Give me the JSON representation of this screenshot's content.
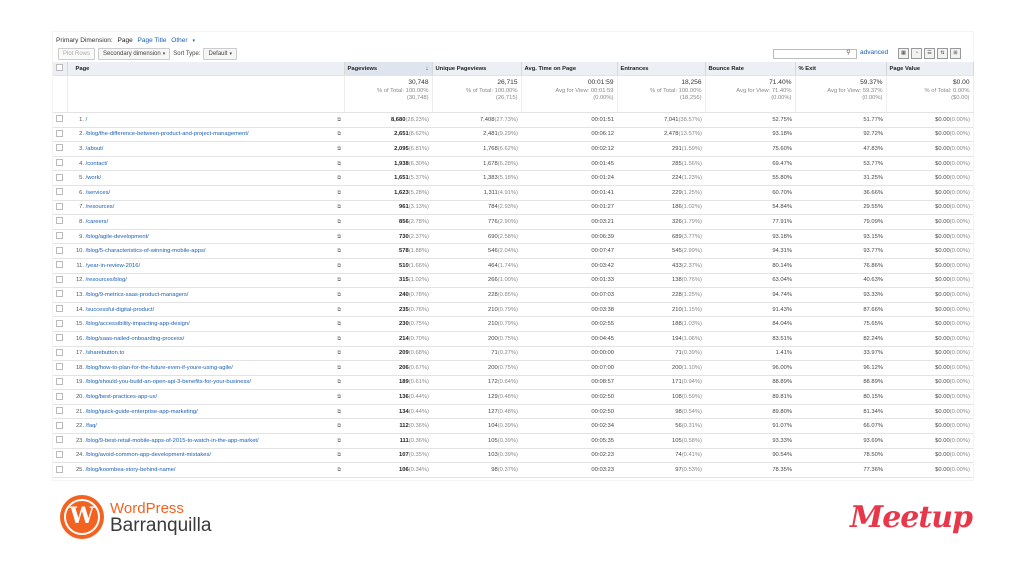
{
  "primary_dimension": {
    "label": "Primary Dimension:",
    "selected": "Page",
    "option_page_title": "Page Title",
    "option_other": "Other"
  },
  "controls": {
    "plot_rows": "Plot Rows",
    "secondary_dimension": "Secondary dimension",
    "sort_type_label": "Sort Type:",
    "sort_type_value": "Default",
    "advanced": "advanced"
  },
  "columns": [
    "Page",
    "Pageviews",
    "Unique Pageviews",
    "Avg. Time on Page",
    "Entrances",
    "Bounce Rate",
    "% Exit",
    "Page Value"
  ],
  "totals": [
    {
      "big": "30,748",
      "l1": "% of Total: 100.00%",
      "l2": "(30,748)"
    },
    {
      "big": "26,715",
      "l1": "% of Total: 100.00%",
      "l2": "(26,715)"
    },
    {
      "big": "00:01:59",
      "l1": "Avg for View: 00:01:59",
      "l2": "(0.00%)"
    },
    {
      "big": "18,256",
      "l1": "% of Total: 100.00%",
      "l2": "(18,256)"
    },
    {
      "big": "71.40%",
      "l1": "Avg for View: 71.40%",
      "l2": "(0.00%)"
    },
    {
      "big": "59.37%",
      "l1": "Avg for View: 59.37%",
      "l2": "(0.00%)"
    },
    {
      "big": "$0.00",
      "l1": "% of Total: 0.00%",
      "l2": "($0.00)"
    }
  ],
  "rows": [
    [
      "1.",
      "/",
      "8,680",
      "(28.23%)",
      "7,408",
      "(27.73%)",
      "00:01:51",
      "7,041",
      "(38.57%)",
      "52.75%",
      "51.77%",
      "$0.00",
      "(0.00%)"
    ],
    [
      "2.",
      "/blog/the-difference-between-product-and-project-management/",
      "2,651",
      "(8.62%)",
      "2,481",
      "(9.29%)",
      "00:06:12",
      "2,478",
      "(13.57%)",
      "93.18%",
      "92.72%",
      "$0.00",
      "(0.00%)"
    ],
    [
      "3.",
      "/about/",
      "2,095",
      "(6.81%)",
      "1,768",
      "(6.62%)",
      "00:02:12",
      "291",
      "(1.59%)",
      "75.60%",
      "47.83%",
      "$0.00",
      "(0.00%)"
    ],
    [
      "4.",
      "/contact/",
      "1,938",
      "(6.30%)",
      "1,678",
      "(6.28%)",
      "00:01:45",
      "285",
      "(1.56%)",
      "69.47%",
      "53.77%",
      "$0.00",
      "(0.00%)"
    ],
    [
      "5.",
      "/work/",
      "1,651",
      "(5.37%)",
      "1,383",
      "(5.18%)",
      "00:01:24",
      "224",
      "(1.23%)",
      "55.80%",
      "31.25%",
      "$0.00",
      "(0.00%)"
    ],
    [
      "6.",
      "/services/",
      "1,623",
      "(5.28%)",
      "1,311",
      "(4.91%)",
      "00:01:41",
      "229",
      "(1.25%)",
      "60.70%",
      "36.66%",
      "$0.00",
      "(0.00%)"
    ],
    [
      "7.",
      "/resources/",
      "961",
      "(3.13%)",
      "784",
      "(2.93%)",
      "00:01:27",
      "186",
      "(1.02%)",
      "54.84%",
      "29.55%",
      "$0.00",
      "(0.00%)"
    ],
    [
      "8.",
      "/careers/",
      "856",
      "(2.78%)",
      "776",
      "(2.90%)",
      "00:03:21",
      "326",
      "(1.79%)",
      "77.91%",
      "79.09%",
      "$0.00",
      "(0.00%)"
    ],
    [
      "9.",
      "/blog/agile-development/",
      "730",
      "(2.37%)",
      "690",
      "(2.58%)",
      "00:06:39",
      "689",
      "(3.77%)",
      "93.18%",
      "93.15%",
      "$0.00",
      "(0.00%)"
    ],
    [
      "10.",
      "/blog/5-characteristics-of-winning-mobile-apps/",
      "578",
      "(1.88%)",
      "546",
      "(2.04%)",
      "00:07:47",
      "545",
      "(2.99%)",
      "94.31%",
      "93.77%",
      "$0.00",
      "(0.00%)"
    ],
    [
      "11.",
      "/year-in-review-2016/",
      "510",
      "(1.66%)",
      "464",
      "(1.74%)",
      "00:03:42",
      "433",
      "(2.37%)",
      "80.14%",
      "76.86%",
      "$0.00",
      "(0.00%)"
    ],
    [
      "12.",
      "/resources/blog/",
      "315",
      "(1.02%)",
      "266",
      "(1.00%)",
      "00:01:33",
      "138",
      "(0.76%)",
      "63.04%",
      "40.63%",
      "$0.00",
      "(0.00%)"
    ],
    [
      "13.",
      "/blog/9-metrics-saas-product-managers/",
      "240",
      "(0.78%)",
      "228",
      "(0.85%)",
      "00:07:03",
      "228",
      "(1.25%)",
      "94.74%",
      "93.33%",
      "$0.00",
      "(0.00%)"
    ],
    [
      "14.",
      "/successful-digital-product/",
      "235",
      "(0.76%)",
      "210",
      "(0.79%)",
      "00:03:38",
      "210",
      "(1.15%)",
      "91.43%",
      "87.66%",
      "$0.00",
      "(0.00%)"
    ],
    [
      "15.",
      "/blog/accessibility-impacting-app-design/",
      "230",
      "(0.75%)",
      "210",
      "(0.79%)",
      "00:02:55",
      "188",
      "(1.03%)",
      "84.04%",
      "75.65%",
      "$0.00",
      "(0.00%)"
    ],
    [
      "16.",
      "/blog/saas-nailed-onboarding-process/",
      "214",
      "(0.70%)",
      "200",
      "(0.75%)",
      "00:04:45",
      "194",
      "(1.06%)",
      "83.51%",
      "82.24%",
      "$0.00",
      "(0.00%)"
    ],
    [
      "17.",
      "/sharebutton.to",
      "209",
      "(0.68%)",
      "71",
      "(0.27%)",
      "00:00:00",
      "71",
      "(0.39%)",
      "1.41%",
      "33.97%",
      "$0.00",
      "(0.00%)"
    ],
    [
      "18.",
      "/blog/how-to-plan-for-the-future-even-if-youre-using-agile/",
      "206",
      "(0.67%)",
      "200",
      "(0.75%)",
      "00:07:00",
      "200",
      "(1.10%)",
      "96.00%",
      "96.12%",
      "$0.00",
      "(0.00%)"
    ],
    [
      "19.",
      "/blog/should-you-build-an-open-api-3-benefits-for-your-business/",
      "189",
      "(0.61%)",
      "172",
      "(0.64%)",
      "00:08:57",
      "171",
      "(0.94%)",
      "88.89%",
      "88.89%",
      "$0.00",
      "(0.00%)"
    ],
    [
      "20.",
      "/blog/best-practices-app-ux/",
      "136",
      "(0.44%)",
      "129",
      "(0.48%)",
      "00:02:50",
      "108",
      "(0.59%)",
      "89.81%",
      "80.15%",
      "$0.00",
      "(0.00%)"
    ],
    [
      "21.",
      "/blog/quick-guide-enterprise-app-marketing/",
      "134",
      "(0.44%)",
      "127",
      "(0.48%)",
      "00:02:50",
      "98",
      "(0.54%)",
      "89.80%",
      "81.34%",
      "$0.00",
      "(0.00%)"
    ],
    [
      "22.",
      "/faq/",
      "112",
      "(0.36%)",
      "104",
      "(0.39%)",
      "00:02:34",
      "56",
      "(0.31%)",
      "91.07%",
      "66.07%",
      "$0.00",
      "(0.00%)"
    ],
    [
      "23.",
      "/blog/9-best-retail-mobile-apps-of-2015-to-watch-in-the-app-market/",
      "111",
      "(0.36%)",
      "105",
      "(0.39%)",
      "00:05:35",
      "105",
      "(0.58%)",
      "93.33%",
      "93.69%",
      "$0.00",
      "(0.00%)"
    ],
    [
      "24.",
      "/blog/avoid-common-app-development-mistakes/",
      "107",
      "(0.35%)",
      "103",
      "(0.39%)",
      "00:02:23",
      "74",
      "(0.41%)",
      "90.54%",
      "78.50%",
      "$0.00",
      "(0.00%)"
    ],
    [
      "25.",
      "/blog/koombea-story-behind-name/",
      "106",
      "(0.34%)",
      "98",
      "(0.37%)",
      "00:03:23",
      "97",
      "(0.53%)",
      "78.35%",
      "77.36%",
      "$0.00",
      "(0.00%)"
    ]
  ],
  "footer": {
    "wp_line1": "WordPress",
    "wp_line2": "Barranquilla",
    "meetup": "Meetup"
  },
  "colors": {
    "wordpress_orange": "#f26322",
    "meetup_red": "#e8364a",
    "link_blue": "#1a5fb4"
  }
}
